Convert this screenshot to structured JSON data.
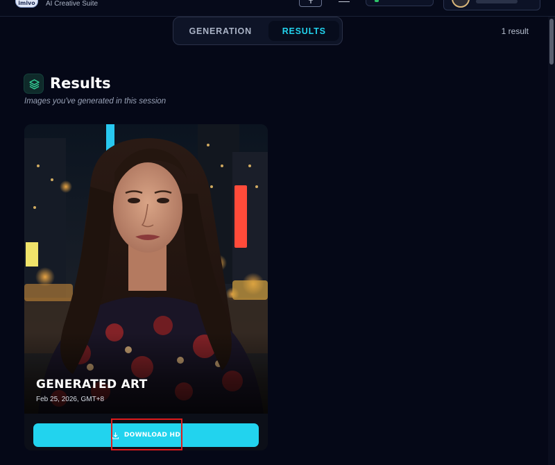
{
  "header": {
    "logo_text": "imivo",
    "brand_subtitle": "AI Creative Suite"
  },
  "tabs": [
    {
      "label": "GENERATION",
      "active": false
    },
    {
      "label": "RESULTS",
      "active": true
    }
  ],
  "result_count": "1 result",
  "section": {
    "title": "Results",
    "subtitle": "Images you've generated in this session",
    "icon": "layers-icon"
  },
  "card": {
    "title": "GENERATED ART",
    "date": "Feb 25, 2026, GMT+8",
    "download_label": "DOWNLOAD HD",
    "download_icon": "download-icon"
  },
  "colors": {
    "background": "#050817",
    "accent": "#22d3ee",
    "highlight": "#e01b1b"
  }
}
